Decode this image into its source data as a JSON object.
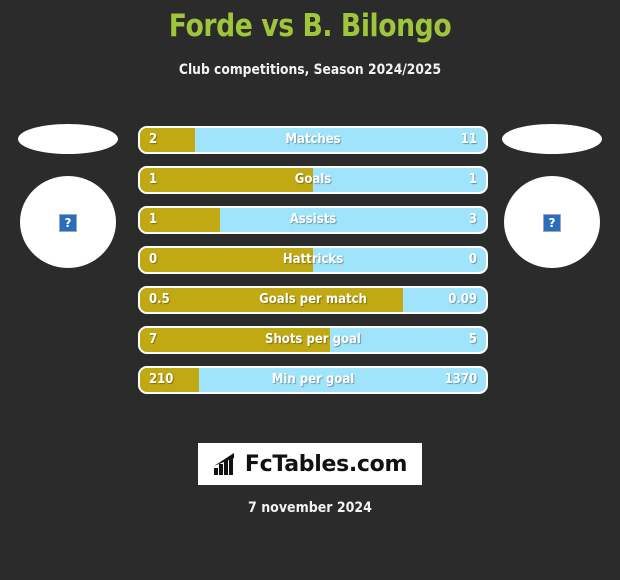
{
  "header": {
    "title": "Forde vs B. Bilongo",
    "subtitle": "Club competitions, Season 2024/2025",
    "title_color": "#9fc63b"
  },
  "players": {
    "left": {
      "photo_placeholder": "broken-image-icon",
      "glyph": "?"
    },
    "right": {
      "photo_placeholder": "broken-image-icon",
      "glyph": "?"
    }
  },
  "colors": {
    "background": "#2b2b2b",
    "home_bar": "#c0a912",
    "away_bar": "#a0e4fb",
    "bar_border": "#ffffff",
    "text": "#ffffff"
  },
  "stats": [
    {
      "label": "Matches",
      "home": "2",
      "away": "11",
      "home_pct": 16
    },
    {
      "label": "Goals",
      "home": "1",
      "away": "1",
      "home_pct": 50
    },
    {
      "label": "Assists",
      "home": "1",
      "away": "3",
      "home_pct": 23
    },
    {
      "label": "Hattricks",
      "home": "0",
      "away": "0",
      "home_pct": 50
    },
    {
      "label": "Goals per match",
      "home": "0.5",
      "away": "0.09",
      "home_pct": 76
    },
    {
      "label": "Shots per goal",
      "home": "7",
      "away": "5",
      "home_pct": 55
    },
    {
      "label": "Min per goal",
      "home": "210",
      "away": "1370",
      "home_pct": 17
    }
  ],
  "footer": {
    "logo_text": "FcTables.com",
    "logo_icon": "bar-chart-arrow-icon",
    "date": "7 november 2024"
  }
}
